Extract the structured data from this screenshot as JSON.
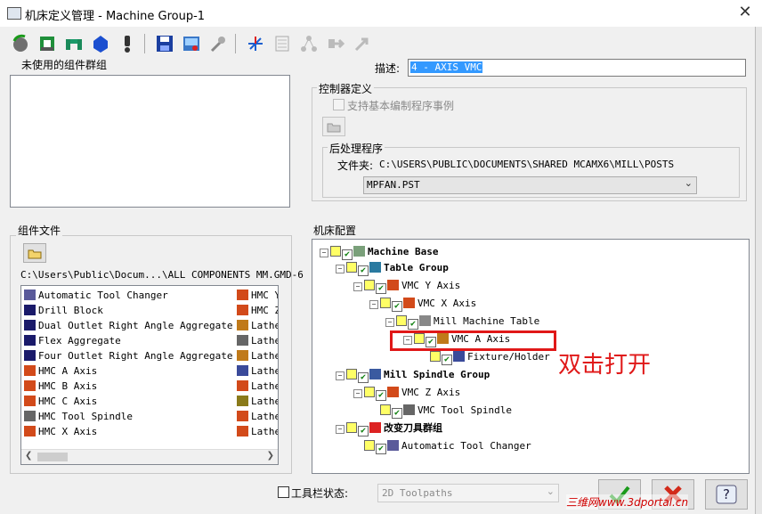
{
  "window": {
    "title": "机床定义管理 - Machine Group-1"
  },
  "toolbar": {
    "icons": [
      "rotary-axis-icon",
      "linear-axis-icon",
      "spindle-head-icon",
      "component-icon",
      "warning-icon",
      "save-icon",
      "machine-view-icon",
      "wrench-icon",
      "axes-icon",
      "table-icon",
      "tree-icon",
      "export-icon",
      "import-icon"
    ]
  },
  "unused_group": {
    "label": "未使用的组件群组"
  },
  "description": {
    "label": "描述:",
    "value": "4 - AXIS VMC"
  },
  "controller": {
    "label": "控制器定义",
    "checkbox_label": "支持基本编制程序事例",
    "post": {
      "label": "后处理程序",
      "folder_label": "文件夹:",
      "folder_path": "C:\\USERS\\PUBLIC\\DOCUMENTS\\SHARED MCAMX6\\MILL\\POSTS",
      "selected": "MPFAN.PST"
    }
  },
  "component_files": {
    "label": "组件文件",
    "path": "C:\\Users\\Public\\Docum...\\ALL COMPONENTS MM.GMD-6",
    "col1": [
      "Automatic Tool Changer",
      "Drill Block",
      "Dual Outlet Right Angle Aggregate",
      "Flex Aggregate",
      "Four Outlet Right Angle Aggregate",
      "HMC A Axis",
      "HMC B Axis",
      "HMC C Axis",
      "HMC Tool Spindle",
      "HMC X Axis"
    ],
    "col2": [
      "HMC Y",
      "HMC Z",
      "Lathe",
      "Lathe",
      "Lathe",
      "Lathe",
      "Lathe",
      "Lathe",
      "Lathe",
      "Lathe"
    ]
  },
  "machine_config": {
    "label": "机床配置",
    "nodes": [
      {
        "text": "Machine Base",
        "bold": true
      },
      {
        "text": "Table Group",
        "bold": true
      },
      {
        "text": "VMC Y Axis",
        "bold": false
      },
      {
        "text": "VMC X Axis",
        "bold": false
      },
      {
        "text": "Mill Machine Table",
        "bold": false
      },
      {
        "text": "VMC A Axis",
        "bold": false
      },
      {
        "text": "Fixture/Holder",
        "bold": false
      },
      {
        "text": "Mill Spindle Group",
        "bold": true
      },
      {
        "text": "VMC Z Axis",
        "bold": false
      },
      {
        "text": "VMC Tool Spindle",
        "bold": false
      },
      {
        "text": "改变刀具群组",
        "bold": true
      },
      {
        "text": "Automatic Tool Changer",
        "bold": false
      }
    ],
    "annotation": "双击打开"
  },
  "bottom": {
    "toolbar_state_label": "工具栏状态:",
    "toolbar_state_value": "2D Toolpaths"
  },
  "watermark": "三维网www.3dportal.cn",
  "colors": {
    "annotation_red": "#e01818",
    "ok_green": "#1a9a1a",
    "cancel_red": "#d22a1a",
    "highlight": "#3399ff"
  }
}
